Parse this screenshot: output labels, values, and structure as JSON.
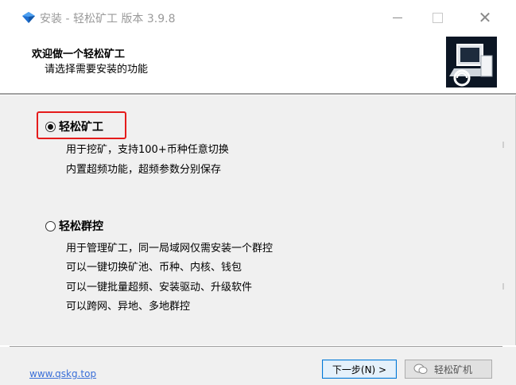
{
  "window": {
    "title": "安装 - 轻松矿工 版本 3.9.8",
    "minimize_icon": "minimize-icon",
    "maximize_icon": "maximize-icon",
    "close_icon": "close-icon",
    "close_glyph": "✕"
  },
  "header": {
    "title": "欢迎做一个轻松矿工",
    "subtitle": "请选择需要安装的功能",
    "image": "installer-computer-icon"
  },
  "options": [
    {
      "label": "轻松矿工",
      "checked": true,
      "desc": [
        "用于挖矿，支持100+币种任意切换",
        "内置超频功能，超频参数分别保存"
      ]
    },
    {
      "label": "轻松群控",
      "checked": false,
      "desc": [
        "用于管理矿工，同一局域网仅需安装一个群控",
        "可以一键切换矿池、币种、内核、钱包",
        "可以一键批量超频、安装驱动、升级软件",
        "可以跨网、异地、多地群控"
      ]
    }
  ],
  "footer": {
    "link": "www.qskg.top",
    "next_button": "下一步(N) >",
    "watermark": "轻松矿机"
  },
  "colors": {
    "highlight": "#e51b1b",
    "link": "#3a6fd8",
    "accent": "#0078d7"
  }
}
